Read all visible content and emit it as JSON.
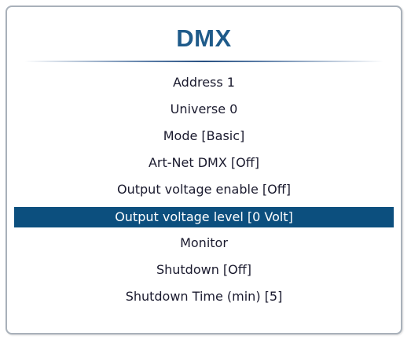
{
  "window": {
    "title": "DMX",
    "accent_color": "#1f5b8a",
    "selection_color": "#0c4f7e"
  },
  "menu": {
    "items": [
      {
        "label": "Address   1",
        "selected": false
      },
      {
        "label": "Universe   0",
        "selected": false
      },
      {
        "label": "Mode [Basic]",
        "selected": false
      },
      {
        "label": "Art-Net DMX [Off]",
        "selected": false
      },
      {
        "label": "Output voltage enable [Off]",
        "selected": false
      },
      {
        "label": "Output voltage level [0 Volt]",
        "selected": true
      },
      {
        "label": "Monitor",
        "selected": false
      },
      {
        "label": "Shutdown [Off]",
        "selected": false
      },
      {
        "label": "Shutdown Time (min) [5]",
        "selected": false
      }
    ]
  }
}
